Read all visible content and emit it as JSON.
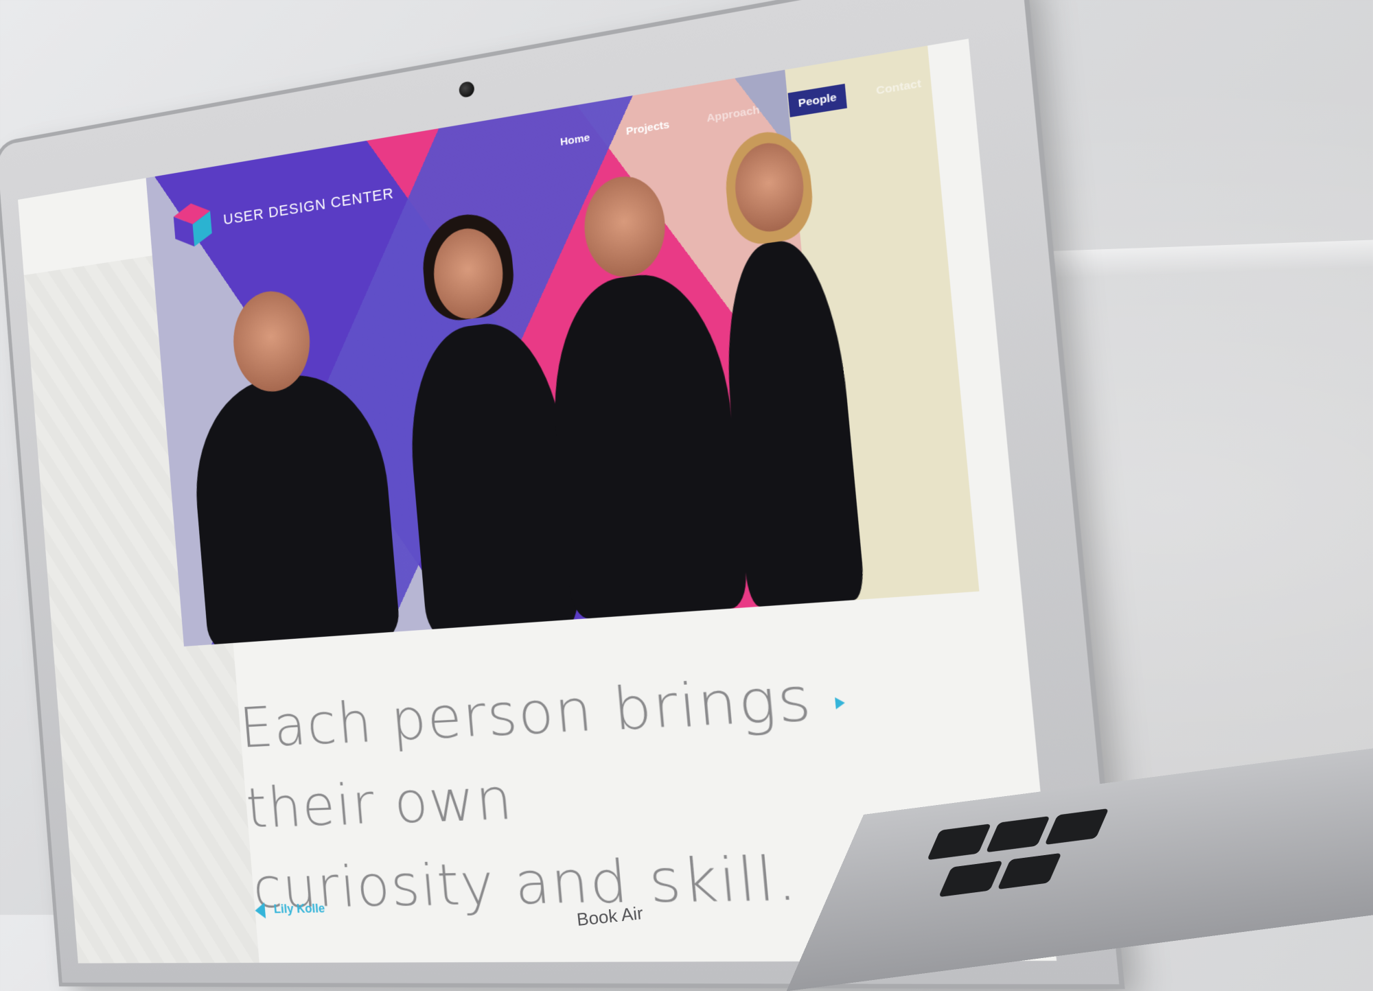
{
  "site": {
    "logo_text": "USER DESIGN CENTER",
    "nav": [
      {
        "label": "Home"
      },
      {
        "label": "Projects"
      },
      {
        "label": "Approach"
      },
      {
        "label": "People"
      },
      {
        "label": "Contact"
      }
    ],
    "active_nav": "People",
    "headline_line1": "Each person brings their own",
    "headline_line2": "curiosity and skill.",
    "caption_name": "Lily Kolle"
  },
  "device": {
    "brand_text": "Book Air"
  },
  "colors": {
    "accent_teal": "#34b4d9",
    "nav_active_bg": "#2a2f86",
    "hero_pink": "#e93a86",
    "hero_purple": "#5a3cc4"
  }
}
